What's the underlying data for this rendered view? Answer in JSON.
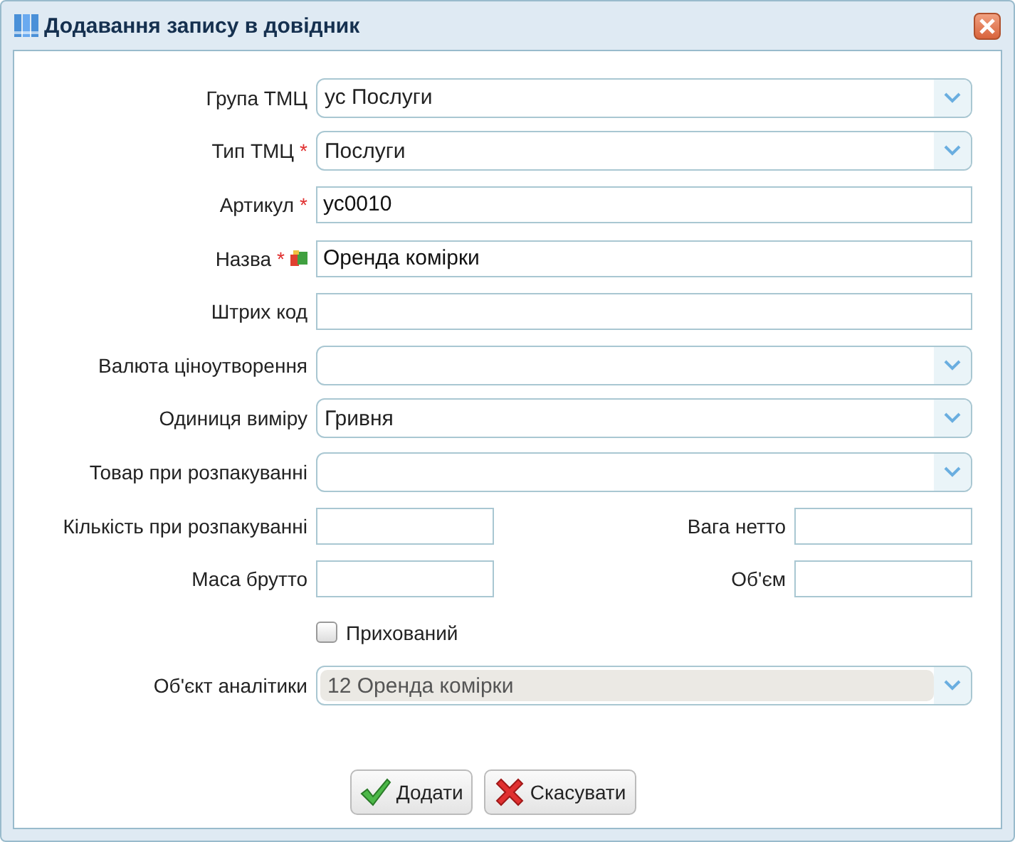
{
  "window": {
    "title": "Додавання запису в довідник"
  },
  "rows": [
    {
      "kind": "select",
      "label": "Група ТМЦ",
      "translatable": false,
      "disabled": false,
      "value": "ус Послуги"
    },
    {
      "kind": "select",
      "label": "Тип ТМЦ",
      "required_mark": "*",
      "translatable": false,
      "disabled": false,
      "value": "Послуги"
    },
    {
      "kind": "text",
      "label": "Артикул",
      "required_mark": "*",
      "translatable": false,
      "value": "ус0010"
    },
    {
      "kind": "text",
      "label": "Назва",
      "required_mark": "*",
      "translatable": true,
      "value": "Оренда комірки"
    },
    {
      "kind": "text",
      "label": "Штрих код",
      "translatable": false
    },
    {
      "kind": "select",
      "label": "Валюта ціноутворення",
      "translatable": false,
      "disabled": false
    },
    {
      "kind": "select",
      "label": "Одиниця виміру",
      "translatable": false,
      "disabled": false,
      "value": "Гривня"
    },
    {
      "kind": "select",
      "label": "Товар при розпакуванні",
      "translatable": false,
      "disabled": false
    },
    {
      "kind": "pair",
      "items": [
        {
          "label": "Кількість при розпакуванні"
        },
        {
          "label": "Вага нетто"
        }
      ]
    },
    {
      "kind": "pair",
      "items": [
        {
          "label": "Маса брутто"
        },
        {
          "label": "Об'єм"
        }
      ]
    },
    {
      "kind": "checkbox",
      "label": "Прихований",
      "checked": false
    },
    {
      "kind": "select",
      "label": "Об'єкт аналітики",
      "translatable": false,
      "disabled": true,
      "value": "12 Оренда комірки"
    }
  ],
  "buttons": [
    {
      "kind": "ok",
      "label": "Додати"
    },
    {
      "kind": "cancel",
      "label": "Скасувати"
    }
  ]
}
